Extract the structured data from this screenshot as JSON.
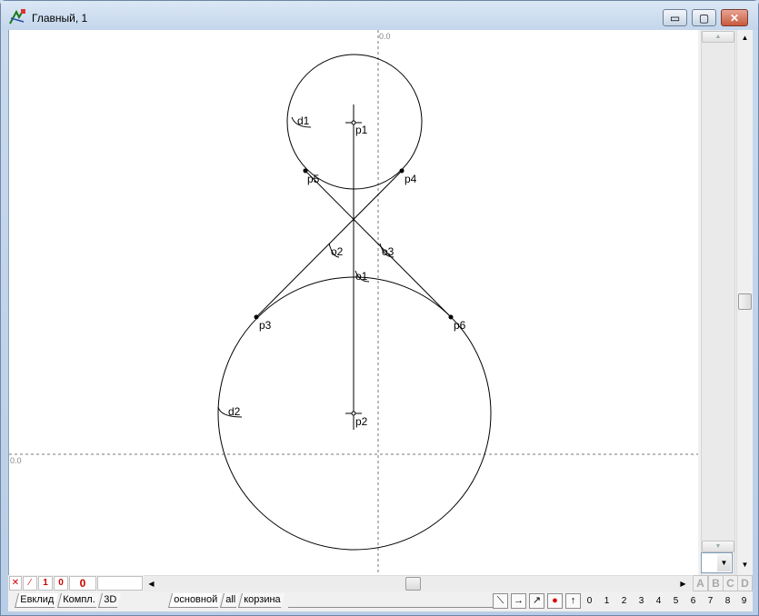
{
  "window": {
    "title": "Главный, 1",
    "buttons": {
      "minimize": "▭",
      "maximize": "▢",
      "close": "✕"
    }
  },
  "canvas": {
    "axis_label_top": "0.0",
    "axis_label_left": "0.0",
    "labels": {
      "d1": "d1",
      "d2": "d2",
      "p1": "p1",
      "p2": "p2",
      "p3": "p3",
      "p4": "p4",
      "p5": "p5",
      "p6": "p6",
      "o1": "o1",
      "o2": "o2",
      "o3": "o3"
    }
  },
  "status": {
    "mini_buttons": [
      "✕",
      "⁄",
      "1",
      "0"
    ],
    "counter": "0"
  },
  "hscroll": {
    "left": "◀",
    "right": "▶"
  },
  "vscroll": {
    "up": "▲",
    "down": "▼"
  },
  "layers": [
    "A",
    "B",
    "C",
    "D"
  ],
  "tabs_left": [
    "Евклид",
    "Компл.",
    "3D"
  ],
  "tabs_right": [
    "основной",
    "all",
    "корзина"
  ],
  "tools": [
    "⟍",
    "→",
    "↗",
    "●",
    "↑"
  ],
  "digits": [
    "0",
    "1",
    "2",
    "3",
    "4",
    "5",
    "6",
    "7",
    "8",
    "9"
  ]
}
